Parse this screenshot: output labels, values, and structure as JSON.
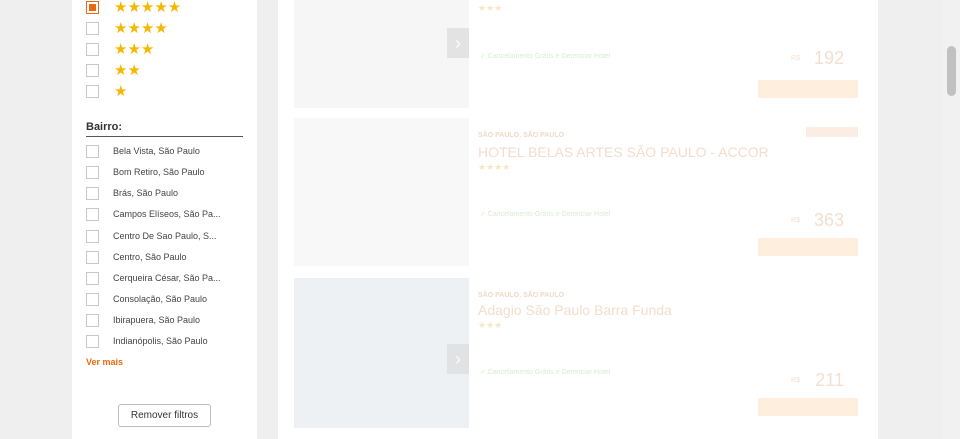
{
  "star_filters": [
    {
      "stars": "★★★★★",
      "checked": true
    },
    {
      "stars": "★★★★",
      "checked": false
    },
    {
      "stars": "★★★",
      "checked": false
    },
    {
      "stars": "★★",
      "checked": false
    },
    {
      "stars": "★",
      "checked": false
    }
  ],
  "neighborhood": {
    "title": "Bairro:",
    "items": [
      "Bela Vista, São Paulo",
      "Bom Retiro, São Paulo",
      "Brás, São Paulo",
      "Campos Elíseos, São Pa...",
      "Centro De Sao Paulo, S...",
      "Centro, São Paulo",
      "Cerqueira César, São Pa...",
      "Consolação, São Paulo",
      "Ibirapuera, São Paulo",
      "Indianópolis, São Paulo"
    ],
    "see_more": "Ver mais"
  },
  "remove_filters": "Remover filtros",
  "hotels": [
    {
      "city": "",
      "name": "",
      "stars": "★★★",
      "cancel_note": "✓ Cancelamento Grátis e Gerenciar Hotel",
      "currency": "R$",
      "price": "192"
    },
    {
      "city": "SÃO PAULO, SÃO PAULO",
      "name": "HOTEL BELAS ARTES SÃO PAULO - ACCOR",
      "stars": "★★★★",
      "cancel_note": "✓ Cancelamento Grátis e Gerenciar Hotel",
      "currency": "R$",
      "price": "363"
    },
    {
      "city": "SÃO PAULO, SÃO PAULO",
      "name": "Adagio São Paulo Barra Funda",
      "stars": "★★★",
      "cancel_note": "✓ Cancelamento Grátis e Gerenciar Hotel",
      "currency": "R$",
      "price": "211"
    }
  ],
  "icons": {
    "next": "›"
  },
  "colors": {
    "accent": "#e96a12",
    "star": "#f5b800"
  }
}
